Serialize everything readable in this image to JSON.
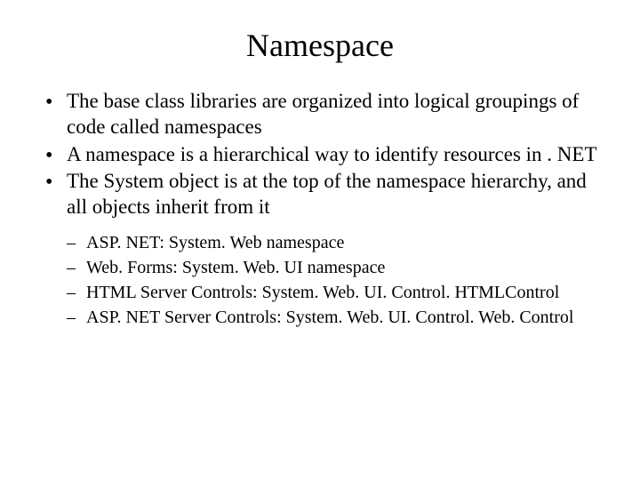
{
  "title": "Namespace",
  "bullets": [
    "The base class libraries are organized into logical groupings of code called namespaces",
    "A namespace is a hierarchical way to identify resources in . NET",
    "The System object is at the top of the namespace hierarchy, and all objects inherit from it"
  ],
  "subbullets": [
    "ASP. NET: System. Web namespace",
    "Web. Forms: System. Web. UI namespace",
    "HTML Server Controls: System. Web. UI. Control. HTMLControl",
    "ASP. NET Server Controls: System. Web. UI. Control. Web. Control"
  ]
}
